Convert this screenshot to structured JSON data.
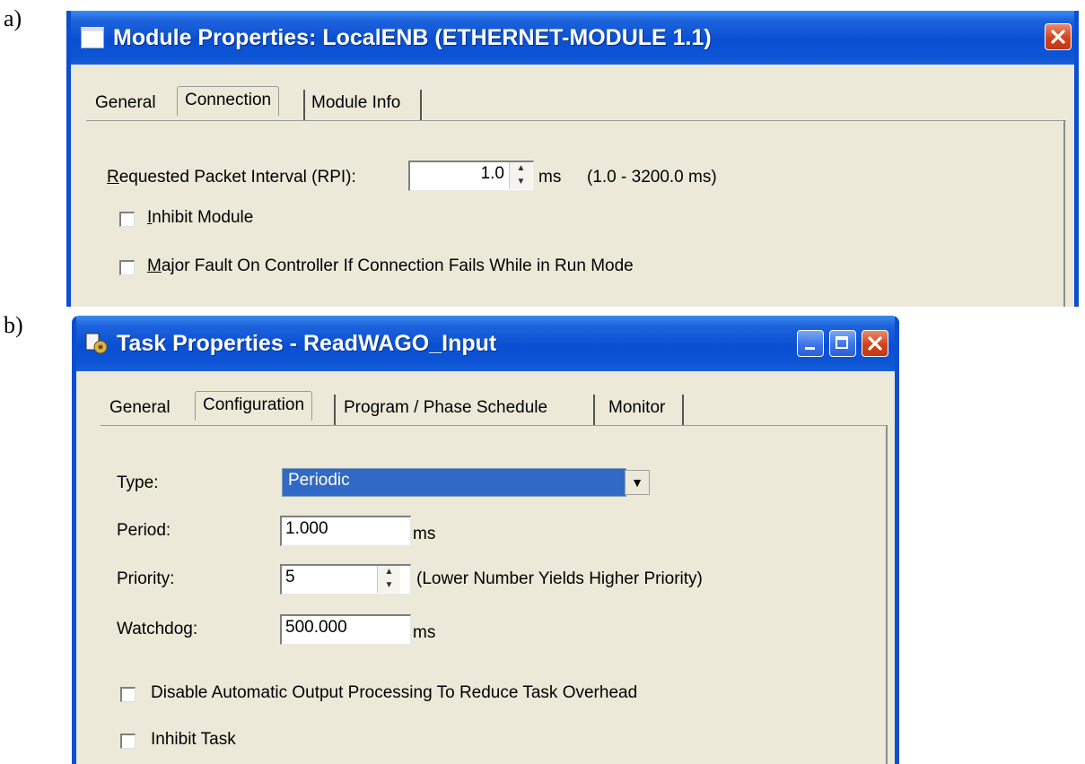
{
  "labels": {
    "a": "a)",
    "b": "b)"
  },
  "module_dialog": {
    "title": "Module Properties: LocalENB (ETHERNET-MODULE 1.1)",
    "tabs": [
      "General",
      "Connection",
      "Module Info"
    ],
    "active_tab": "Connection",
    "rpi": {
      "label_first": "R",
      "label_rest": "equested Packet Interval (RPI):",
      "value": "1.0",
      "unit": "ms",
      "range": "(1.0 - 3200.0 ms)"
    },
    "inhibit_module": {
      "label_first": "I",
      "label_rest": "nhibit Module",
      "checked": false
    },
    "major_fault": {
      "label_first": "M",
      "label_rest": "ajor Fault On Controller If Connection Fails While in Run Mode",
      "checked": false
    }
  },
  "task_dialog": {
    "title": "Task Properties - ReadWAGO_Input",
    "tabs": [
      "General",
      "Configuration",
      "Program / Phase Schedule",
      "Monitor"
    ],
    "active_tab": "Configuration",
    "type": {
      "label": "Type:",
      "value": "Periodic"
    },
    "period": {
      "label": "Period:",
      "value": "1.000",
      "unit": "ms"
    },
    "priority": {
      "label": "Priority:",
      "value": "5",
      "hint": "(Lower Number Yields Higher Priority)"
    },
    "watchdog": {
      "label": "Watchdog:",
      "value": "500.000",
      "unit": "ms"
    },
    "disable_output": {
      "label": "Disable Automatic Output Processing To Reduce Task Overhead",
      "checked": false
    },
    "inhibit_task": {
      "label": "Inhibit Task",
      "checked": false
    }
  },
  "colors": {
    "titlebar": "#0a4fd2",
    "dialog_bg": "#ece9d8",
    "selection": "#3169c6",
    "close_button": "#d2431d"
  },
  "icons": {
    "module_title": "window-icon",
    "task_title": "task-icon",
    "close": "close-icon",
    "minimize": "minimize-icon",
    "maximize": "maximize-icon"
  }
}
